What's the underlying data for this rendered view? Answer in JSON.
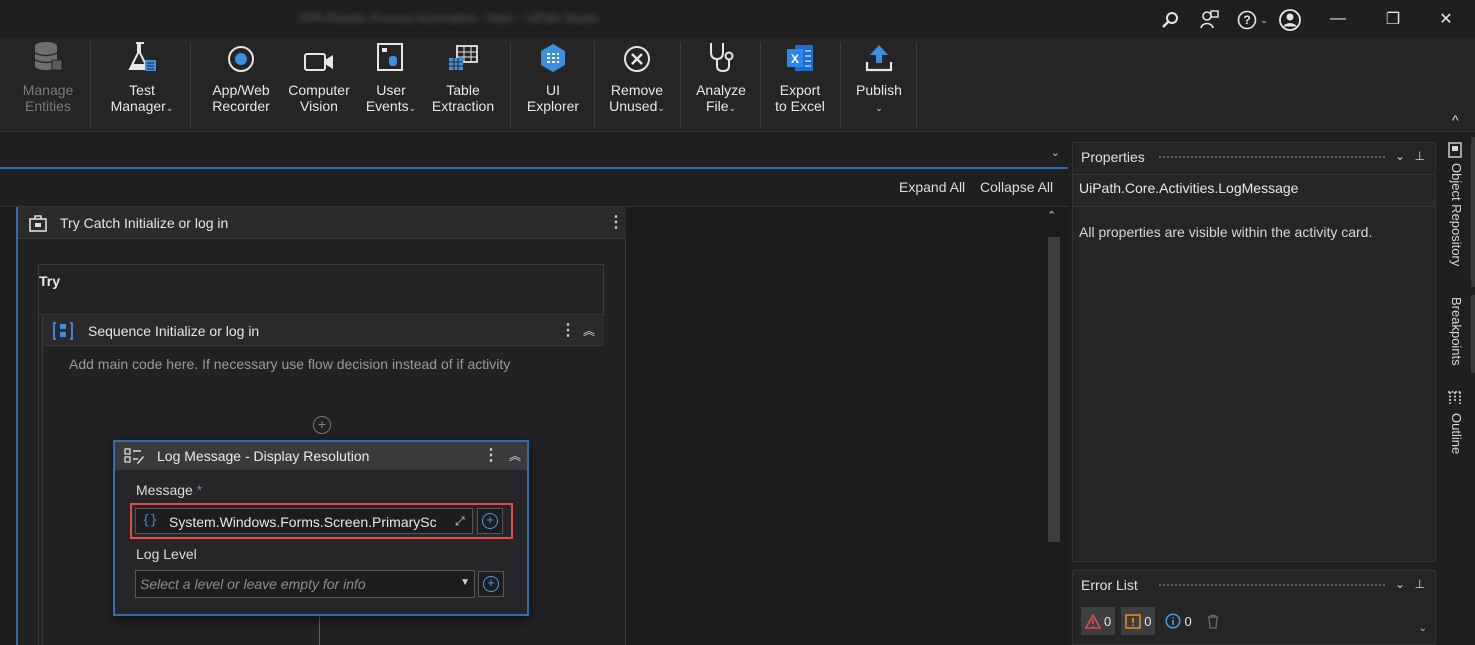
{
  "window": {
    "title": "RPA Robotic Process Automation - Main - UiPath Studio",
    "controls": {
      "minimize": "—",
      "restore": "❐",
      "close": "✕"
    }
  },
  "ribbon": {
    "items": [
      {
        "label": "Manage\nEntities",
        "icon": "database-icon",
        "disabled": true
      },
      {
        "label": "Test\nManager",
        "icon": "flask-icon"
      },
      {
        "label": "App/Web\nRecorder",
        "icon": "record-icon"
      },
      {
        "label": "Computer\nVision",
        "icon": "video-camera-icon"
      },
      {
        "label": "User\nEvents",
        "icon": "user-events-icon"
      },
      {
        "label": "Table\nExtraction",
        "icon": "table-extraction-icon"
      },
      {
        "label": "UI\nExplorer",
        "icon": "ui-explorer-icon"
      },
      {
        "label": "Remove\nUnused",
        "icon": "remove-icon"
      },
      {
        "label": "Analyze\nFile",
        "icon": "stethoscope-icon"
      },
      {
        "label": "Export\nto Excel",
        "icon": "excel-icon"
      },
      {
        "label": "Publish",
        "icon": "publish-icon"
      }
    ],
    "collapse_glyph": "^"
  },
  "designer": {
    "expand_all": "Expand All",
    "collapse_all": "Collapse All",
    "try_catch_title": "Try Catch Initialize or log in",
    "try_label": "Try",
    "sequence_title": "Sequence Initialize or log in",
    "sequence_hint": "Add main code here. If necessary use flow decision instead of if activity",
    "log_message": {
      "title": "Log Message - Display Resolution",
      "message_label": "Message",
      "required_mark": "*",
      "message_value": "System.Windows.Forms.Screen.PrimarySc",
      "log_level_label": "Log Level",
      "log_level_placeholder": "Select a level or leave empty for info"
    }
  },
  "properties": {
    "title": "Properties",
    "activity_type": "UiPath.Core.Activities.LogMessage",
    "message": "All properties are visible within the activity card."
  },
  "error_list": {
    "title": "Error List",
    "errors": "0",
    "warnings": "0",
    "infos": "0"
  },
  "dock_rail": {
    "object_repository": "Object Repository",
    "breakpoints": "Breakpoints",
    "outline": "Outline"
  },
  "colors": {
    "accent": "#1e6fb8",
    "highlight": "#e34b4b",
    "ui_explorer": "#3d8fe0"
  }
}
